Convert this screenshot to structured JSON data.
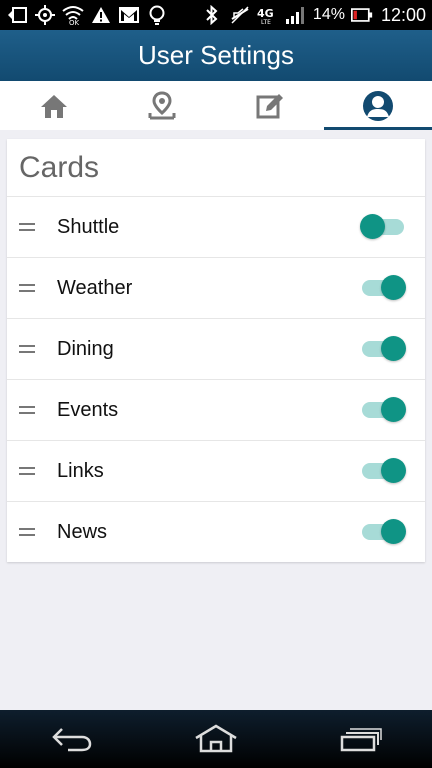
{
  "status_bar": {
    "battery_percent": "14%",
    "time": "12:00",
    "left_icons": [
      "back-arrow-icon",
      "gps-icon",
      "wifi-ok-icon",
      "warning-icon",
      "gmail-icon",
      "lightbulb-icon"
    ],
    "right_icons": [
      "bluetooth-icon",
      "mute-icon",
      "4g-lte-icon",
      "signal-icon",
      "battery-icon"
    ]
  },
  "app_bar": {
    "title": "User Settings"
  },
  "tabs": [
    {
      "icon": "home-icon",
      "active": false
    },
    {
      "icon": "map-pin-icon",
      "active": false
    },
    {
      "icon": "edit-icon",
      "active": false
    },
    {
      "icon": "user-icon",
      "active": true
    }
  ],
  "cards": {
    "title": "Cards",
    "items": [
      {
        "label": "Shuttle",
        "enabled": false
      },
      {
        "label": "Weather",
        "enabled": true
      },
      {
        "label": "Dining",
        "enabled": true
      },
      {
        "label": "Events",
        "enabled": true
      },
      {
        "label": "Links",
        "enabled": true
      },
      {
        "label": "News",
        "enabled": true
      }
    ]
  },
  "colors": {
    "app_bar": "#124a70",
    "toggle_knob": "#0f9485",
    "toggle_track": "#a7dbd7",
    "page_bg": "#efeff4"
  },
  "nav_bar": {
    "buttons": [
      "back-icon",
      "home-icon",
      "recent-apps-icon"
    ]
  }
}
